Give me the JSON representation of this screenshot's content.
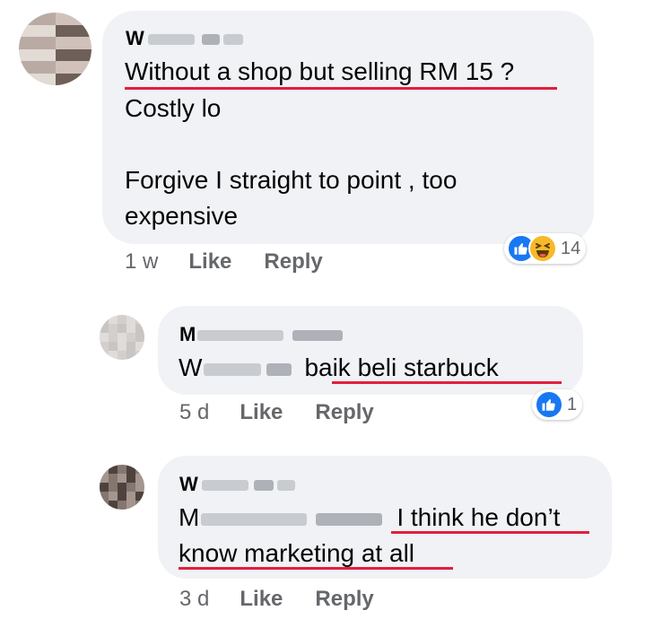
{
  "comments": [
    {
      "name_visible": "W",
      "text_line1": "Without a shop but selling RM 15 ?",
      "text_line2": "Costly lo",
      "text_line3": "Forgive I straight to point , too",
      "text_line4": "expensive",
      "time": "1 w",
      "like_label": "Like",
      "reply_label": "Reply",
      "reaction_count": "14",
      "reactions": [
        "like-icon",
        "haha-icon"
      ]
    },
    {
      "name_visible": "M",
      "text_prefix_visible": "W",
      "text": "baik beli starbuck",
      "time": "5 d",
      "like_label": "Like",
      "reply_label": "Reply",
      "reaction_count": "1",
      "reactions": [
        "like-icon"
      ]
    },
    {
      "name_visible": "W",
      "text_prefix_visible": "M",
      "text_line1": "I think he don’t",
      "text_line2": "know marketing at all",
      "time": "3 d",
      "like_label": "Like",
      "reply_label": "Reply"
    }
  ],
  "colors": {
    "bubble": "#f0f2f5",
    "underline": "#e41e3f",
    "like_blue": "#1877f2",
    "haha_yellow": "#f7b928",
    "meta_gray": "#65676b"
  }
}
